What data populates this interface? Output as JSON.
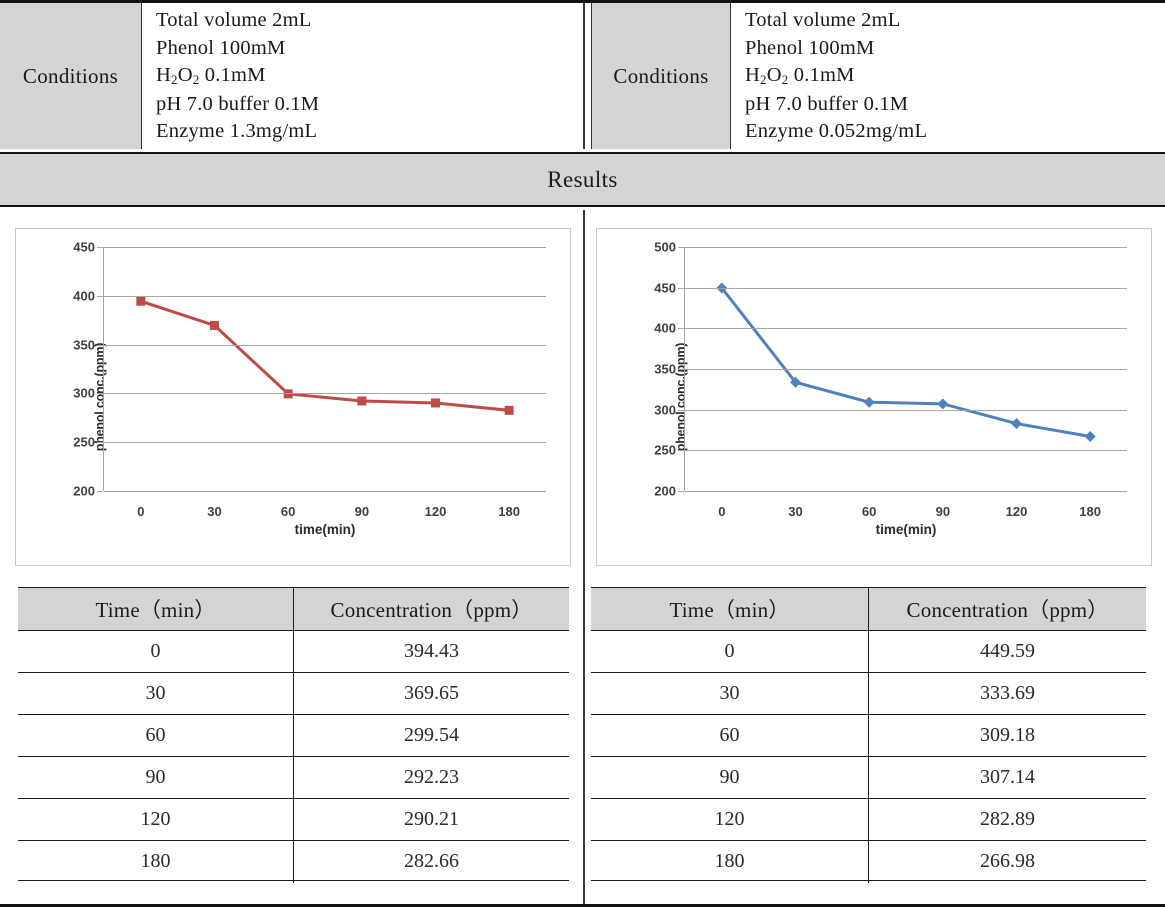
{
  "top_rule": true,
  "conditions": {
    "label": "Conditions",
    "left": {
      "lines": [
        {
          "text": "Total volume  2mL"
        },
        {
          "text": "Phenol  100mM"
        },
        {
          "text": "H2O2  0.1mM",
          "formula": true,
          "pre": "H",
          "sub1": "2",
          "mid": "O",
          "sub2": "2",
          "post": "  0.1mM"
        },
        {
          "text": "pH 7.0  buffer  0.1M"
        },
        {
          "text": "Enzyme  1.3mg/mL"
        }
      ]
    },
    "right": {
      "lines": [
        {
          "text": "Total volume  2mL"
        },
        {
          "text": "Phenol  100mM"
        },
        {
          "text": "H2O2  0.1mM",
          "formula": true,
          "pre": "H",
          "sub1": "2",
          "mid": "O",
          "sub2": "2",
          "post": "  0.1mM"
        },
        {
          "text": "pH 7.0  buffer  0.1M"
        },
        {
          "text": "Enzyme  0.052mg/mL"
        }
      ]
    }
  },
  "results_band": {
    "title": "Results"
  },
  "table_headers": {
    "time": "Time（min）",
    "concentration": "Concentration（ppm）"
  },
  "left_table": {
    "rows": [
      {
        "time": "0",
        "conc": "394.43"
      },
      {
        "time": "30",
        "conc": "369.65"
      },
      {
        "time": "60",
        "conc": "299.54"
      },
      {
        "time": "90",
        "conc": "292.23"
      },
      {
        "time": "120",
        "conc": "290.21"
      },
      {
        "time": "180",
        "conc": "282.66"
      }
    ]
  },
  "right_table": {
    "rows": [
      {
        "time": "0",
        "conc": "449.59"
      },
      {
        "time": "30",
        "conc": "333.69"
      },
      {
        "time": "60",
        "conc": "309.18"
      },
      {
        "time": "90",
        "conc": "307.14"
      },
      {
        "time": "120",
        "conc": "282.89"
      },
      {
        "time": "180",
        "conc": "266.98"
      }
    ]
  },
  "colors": {
    "series_left": "#BE4B48",
    "series_right": "#4F81BD",
    "header_gray": "#D4D4D4",
    "gridline": "#A6A6A6",
    "rule": "#111111"
  },
  "chart_data": [
    {
      "type": "line",
      "id": "left-chart",
      "title": "",
      "xlabel": "time(min)",
      "ylabel": "phenol conc.(ppm)",
      "categories": [
        "0",
        "30",
        "60",
        "90",
        "120",
        "180"
      ],
      "x": [
        0,
        30,
        60,
        90,
        120,
        180
      ],
      "values": [
        394.43,
        369.65,
        299.54,
        292.23,
        290.21,
        282.66
      ],
      "ylim": [
        200,
        450
      ],
      "yticks": [
        200,
        250,
        300,
        350,
        400,
        450
      ],
      "ytick_labels": [
        "200",
        "250",
        "300",
        "350",
        "400",
        "450"
      ],
      "grid": true,
      "legend": false,
      "marker": "square",
      "color": "#BE4B48",
      "series": [
        {
          "name": "phenol conc.",
          "values": [
            394.43,
            369.65,
            299.54,
            292.23,
            290.21,
            282.66
          ]
        }
      ]
    },
    {
      "type": "line",
      "id": "right-chart",
      "title": "",
      "xlabel": "time(min)",
      "ylabel": "phenol conc.(ppm)",
      "categories": [
        "0",
        "30",
        "60",
        "90",
        "120",
        "180"
      ],
      "x": [
        0,
        30,
        60,
        90,
        120,
        180
      ],
      "values": [
        449.59,
        333.69,
        309.18,
        307.14,
        282.89,
        266.98
      ],
      "ylim": [
        200,
        500
      ],
      "yticks": [
        200,
        250,
        300,
        350,
        400,
        450,
        500
      ],
      "ytick_labels": [
        "200",
        "250",
        "300",
        "350",
        "400",
        "450",
        "500"
      ],
      "grid": true,
      "legend": false,
      "marker": "diamond",
      "color": "#4F81BD",
      "series": [
        {
          "name": "phenol conc.",
          "values": [
            449.59,
            333.69,
            309.18,
            307.14,
            282.89,
            266.98
          ]
        }
      ]
    }
  ]
}
